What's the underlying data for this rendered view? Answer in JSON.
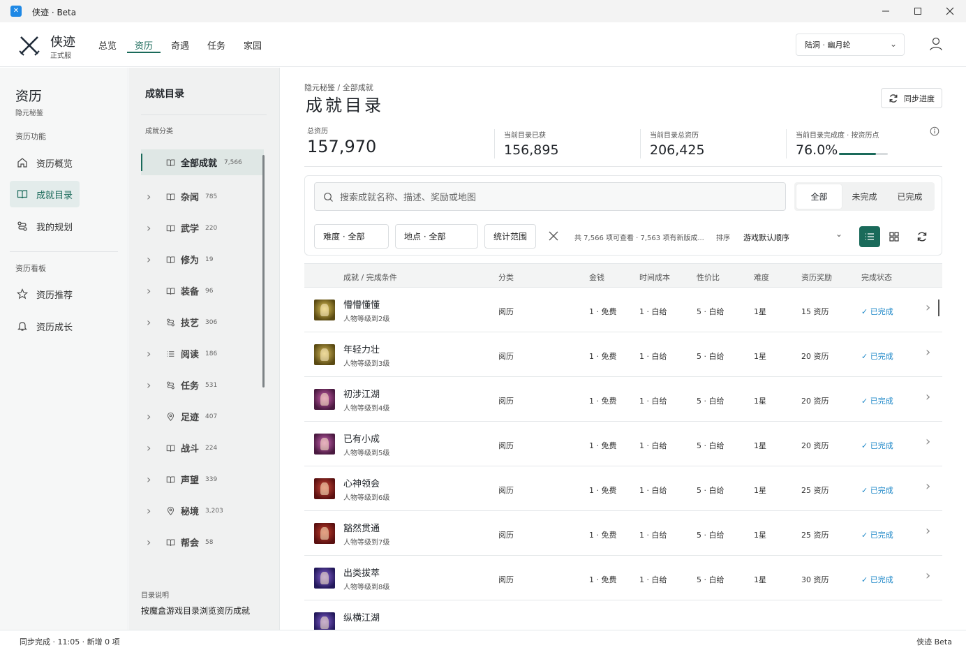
{
  "window": {
    "title": "侠迹 · Beta",
    "min": "—",
    "max": "☐",
    "close": "✕"
  },
  "header": {
    "brand": "侠迹",
    "brand_sub": "正式服",
    "nav": [
      {
        "label": "总览",
        "active": false
      },
      {
        "label": "资历",
        "active": true
      },
      {
        "label": "奇遇",
        "active": false
      },
      {
        "label": "任务",
        "active": false
      },
      {
        "label": "家园",
        "active": false
      }
    ],
    "profile": "陆洞 · 幽月轮"
  },
  "leftnav": {
    "title": "资历",
    "subtitle": "隐元秘鉴",
    "section1": "资历功能",
    "section1_items": [
      {
        "label": "资历概览",
        "icon": "home-icon",
        "active": false
      },
      {
        "label": "成就目录",
        "icon": "book-icon",
        "active": true
      },
      {
        "label": "我的规划",
        "icon": "plan-icon",
        "active": false
      }
    ],
    "section2": "资历看板",
    "section2_items": [
      {
        "label": "资历推荐",
        "icon": "star-icon"
      },
      {
        "label": "资历成长",
        "icon": "bell-icon"
      }
    ]
  },
  "catalog": {
    "title": "成就目录",
    "section": "成就分类",
    "items": [
      {
        "name": "全部成就",
        "count": "7,566",
        "icon": "book-icon",
        "active": true
      },
      {
        "name": "杂闻",
        "count": "785",
        "icon": "book-icon"
      },
      {
        "name": "武学",
        "count": "220",
        "icon": "book-icon"
      },
      {
        "name": "修为",
        "count": "19",
        "icon": "book-icon"
      },
      {
        "name": "装备",
        "count": "96",
        "icon": "book-icon"
      },
      {
        "name": "技艺",
        "count": "306",
        "icon": "route-icon"
      },
      {
        "name": "阅读",
        "count": "186",
        "icon": "list-icon"
      },
      {
        "name": "任务",
        "count": "531",
        "icon": "route-icon"
      },
      {
        "name": "足迹",
        "count": "407",
        "icon": "pin-icon"
      },
      {
        "name": "战斗",
        "count": "224",
        "icon": "book-icon"
      },
      {
        "name": "声望",
        "count": "339",
        "icon": "book-icon"
      },
      {
        "name": "秘境",
        "count": "3,203",
        "icon": "pin-icon"
      },
      {
        "name": "帮会",
        "count": "58",
        "icon": "book-icon"
      }
    ],
    "note_label": "目录说明",
    "note": "按魔盒游戏目录浏览资历成就"
  },
  "main": {
    "breadcrumb": "隐元秘鉴 / 全部成就",
    "title": "成就目录",
    "sync_label": "同步进度",
    "stats": [
      {
        "label": "总资历",
        "value": "157,970"
      },
      {
        "label": "当前目录已获",
        "value": "156,895"
      },
      {
        "label": "当前目录总资历",
        "value": "206,425"
      },
      {
        "label": "当前目录完成度 · 按资历点",
        "value": "76.0%",
        "progress": 0.76
      }
    ],
    "search_placeholder": "搜索成就名称、描述、奖励或地图",
    "status_tabs": [
      {
        "label": "全部",
        "active": true
      },
      {
        "label": "未完成",
        "active": false
      },
      {
        "label": "已完成",
        "active": false
      }
    ],
    "filters": {
      "difficulty": "难度 · 全部",
      "location": "地点 · 全部",
      "scope": "统计范围"
    },
    "result_info": "共 7,566 项可查看 · 7,563 项有新版成...",
    "sort_label": "排序",
    "sort_value": "游戏默认顺序",
    "columns": [
      "成就 / 完成条件",
      "分类",
      "金钱",
      "时间成本",
      "性价比",
      "难度",
      "资历奖励",
      "完成状态"
    ],
    "rows": [
      {
        "name": "懵懵懂懂",
        "cond": "人物等级到2级",
        "category": "阅历",
        "money": "1 · 免费",
        "time": "1 · 白给",
        "value": "5 · 白给",
        "difficulty": "1星",
        "reward": "15 资历",
        "status": "已完成",
        "thumb": [
          "#5a4a12",
          "#e2c75a"
        ]
      },
      {
        "name": "年轻力壮",
        "cond": "人物等级到3级",
        "category": "阅历",
        "money": "1 · 免费",
        "time": "1 · 白给",
        "value": "5 · 白给",
        "difficulty": "1星",
        "reward": "20 资历",
        "status": "已完成",
        "thumb": [
          "#5a4a12",
          "#dcc060"
        ]
      },
      {
        "name": "初涉江湖",
        "cond": "人物等级到4级",
        "category": "阅历",
        "money": "1 · 免费",
        "time": "1 · 白给",
        "value": "5 · 白给",
        "difficulty": "1星",
        "reward": "20 资历",
        "status": "已完成",
        "thumb": [
          "#4a1a40",
          "#d060b0"
        ]
      },
      {
        "name": "已有小成",
        "cond": "人物等级到5级",
        "category": "阅历",
        "money": "1 · 免费",
        "time": "1 · 白给",
        "value": "5 · 白给",
        "difficulty": "1星",
        "reward": "20 资历",
        "status": "已完成",
        "thumb": [
          "#4a1a40",
          "#d066b8"
        ]
      },
      {
        "name": "心神领会",
        "cond": "人物等级到6级",
        "category": "阅历",
        "money": "1 · 免费",
        "time": "1 · 白给",
        "value": "5 · 白给",
        "difficulty": "1星",
        "reward": "25 资历",
        "status": "已完成",
        "thumb": [
          "#5a1010",
          "#d04a3a"
        ]
      },
      {
        "name": "豁然贯通",
        "cond": "人物等级到7级",
        "category": "阅历",
        "money": "1 · 免费",
        "time": "1 · 白给",
        "value": "5 · 白给",
        "difficulty": "1星",
        "reward": "25 资历",
        "status": "已完成",
        "thumb": [
          "#5a1010",
          "#c8402e"
        ]
      },
      {
        "name": "出类拔萃",
        "cond": "人物等级到8级",
        "category": "阅历",
        "money": "1 · 免费",
        "time": "1 · 白给",
        "value": "5 · 白给",
        "difficulty": "1星",
        "reward": "30 资历",
        "status": "已完成",
        "thumb": [
          "#22185a",
          "#8a64d6"
        ]
      },
      {
        "name": "纵横江湖",
        "cond": "",
        "category": "",
        "money": "",
        "time": "",
        "value": "",
        "difficulty": "",
        "reward": "",
        "status": "",
        "thumb": [
          "#22185a",
          "#8a64d6"
        ]
      }
    ]
  },
  "statusbar": {
    "left": "同步完成 · 11:05 · 新增 0 项",
    "right": "侠迹 Beta"
  },
  "colors": {
    "accent": "#1a6a5a",
    "done": "#1e88c8"
  }
}
